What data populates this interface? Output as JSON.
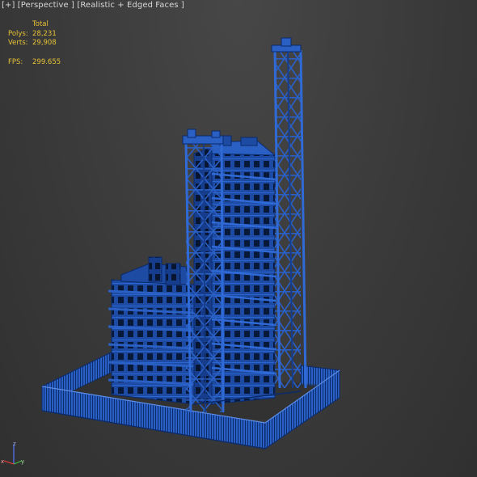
{
  "viewport": {
    "label": "[+] [Perspective ] [Realistic + Edged Faces ]"
  },
  "stats": {
    "total_label": "Total",
    "polys_label": "Polys:",
    "polys_value": "28,231",
    "verts_label": "Verts:",
    "verts_value": "29,908",
    "fps_label": "FPS:",
    "fps_value": "299.655"
  },
  "axis": {
    "z_label": "z",
    "x_label": "x",
    "y_label": "y"
  },
  "colors": {
    "model": "#1f4ea8",
    "model_dark": "#0d2a6e",
    "edge": "#08173c",
    "text": "#e7c234"
  }
}
